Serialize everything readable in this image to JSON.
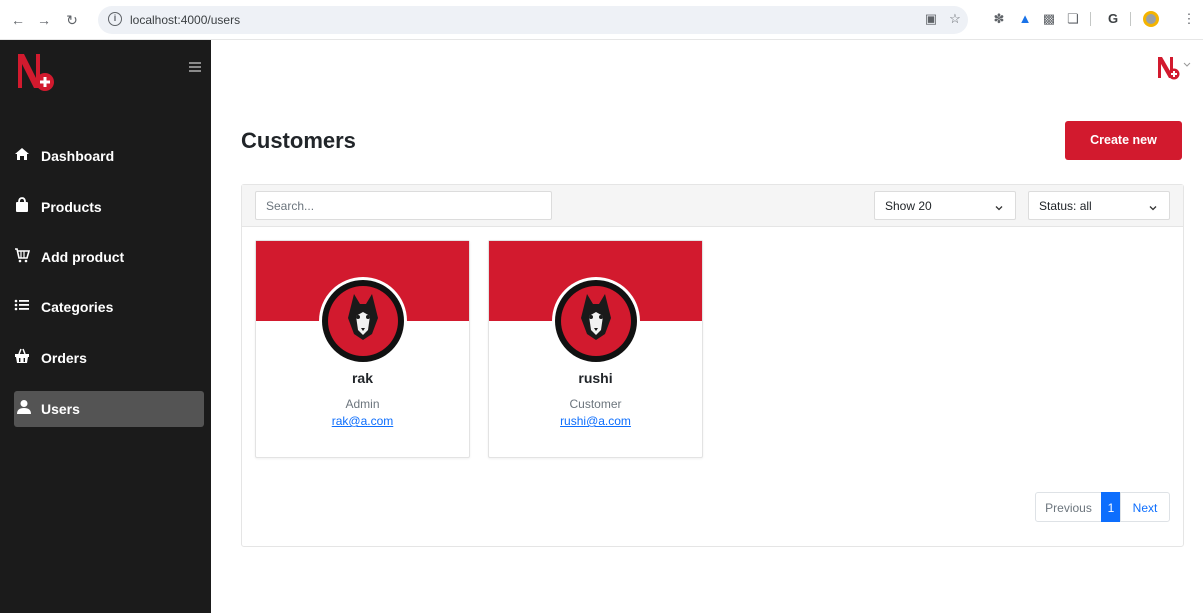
{
  "browser": {
    "url": "localhost:4000/users"
  },
  "sidebar": {
    "items": [
      {
        "label": "Dashboard",
        "icon": "home-icon"
      },
      {
        "label": "Products",
        "icon": "bag-icon"
      },
      {
        "label": "Add product",
        "icon": "cart-icon"
      },
      {
        "label": "Categories",
        "icon": "list-icon"
      },
      {
        "label": "Orders",
        "icon": "basket-icon"
      },
      {
        "label": "Users",
        "icon": "user-icon",
        "active": true
      }
    ]
  },
  "main": {
    "title": "Customers",
    "create_label": "Create new",
    "search_placeholder": "Search...",
    "show_select": "Show 20",
    "status_select": "Status: all",
    "users": [
      {
        "name": "rak",
        "role": "Admin",
        "email": "rak@a.com"
      },
      {
        "name": "rushi",
        "role": "Customer",
        "email": "rushi@a.com"
      }
    ],
    "pagination": {
      "previous": "Previous",
      "current": "1",
      "next": "Next"
    }
  },
  "colors": {
    "brand_red": "#d21a2e",
    "sidebar_bg": "#1b1b1b",
    "link_blue": "#0d6efd"
  }
}
